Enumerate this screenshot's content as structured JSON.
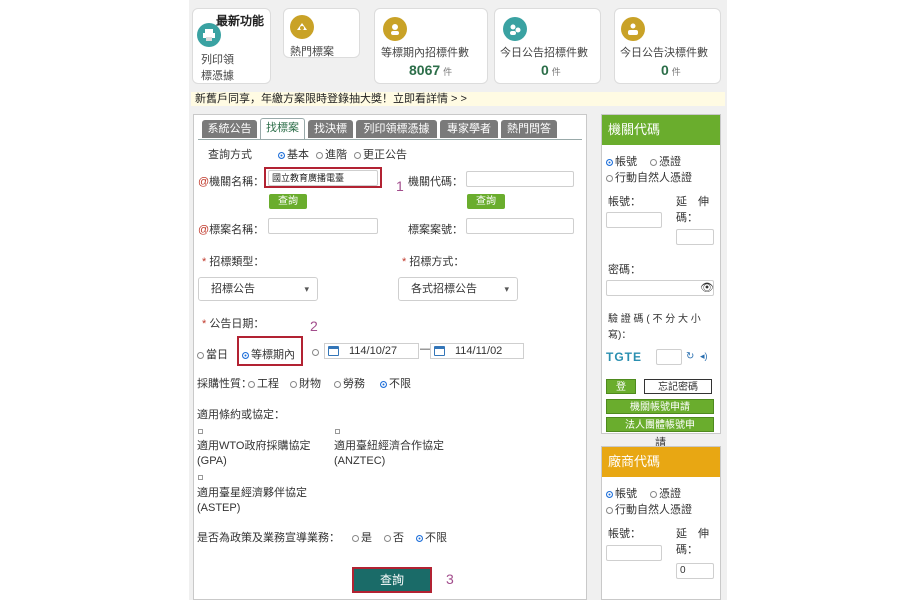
{
  "cards": {
    "latest_title": "最新功能",
    "print_label_1": "列印領",
    "print_label_2": "標憑據",
    "hot_label": "熱門標案",
    "bidding_label": "等標期內招標件數",
    "bidding_count": "8067",
    "today_tender_label": "今日公告招標件數",
    "today_tender_count": "0",
    "today_award_label": "今日公告決標件數",
    "today_award_count": "0",
    "unit": "件"
  },
  "marquee": "新舊戶同享，年繳方案限時登錄抽大獎！立即看詳情 > >",
  "tabs": [
    "系統公告",
    "找標案",
    "找決標",
    "列印領標憑據",
    "專家學者",
    "熱門問答"
  ],
  "form": {
    "query_mode_label": "查詢方式",
    "mode_basic": "基本",
    "mode_advanced": "進階",
    "mode_correction": "更正公告",
    "agency_name_label": "機關名稱：",
    "agency_name_value": "國立教育廣播電臺",
    "agency_code_label": "機關代碼：",
    "query_btn": "查詢",
    "tender_name_label": "標案名稱：",
    "tender_no_label": "標案案號：",
    "tender_type_label": "招標類型：",
    "tender_type_value": "招標公告",
    "tender_method_label": "招標方式：",
    "tender_method_value": "各式招標公告",
    "date_label": "公告日期：",
    "date_today": "當日",
    "date_period": "等標期內",
    "date_from": "114/10/27",
    "date_to": "114/11/02",
    "date_sep": "—",
    "procure_label": "採購性質：",
    "procure_work": "工程",
    "procure_goods": "財物",
    "procure_service": "勞務",
    "procure_all": "不限",
    "treaty_label": "適用條約或協定：",
    "gpa_1": "適用WTO政府採購協定",
    "gpa_2": "(GPA)",
    "anztec_1": "適用臺紐經濟合作協定",
    "anztec_2": "(ANZTEC)",
    "astep_1": "適用臺星經濟夥伴協定",
    "astep_2": "(ASTEP)",
    "policy_label": "是否為政策及業務宣導業務：",
    "policy_yes": "是",
    "policy_no": "否",
    "policy_all": "不限",
    "submit": "查詢"
  },
  "annotations": [
    "1",
    "2",
    "3"
  ],
  "agency_login": {
    "title": "機關代碼",
    "opt_account": "帳號",
    "opt_cert": "憑證",
    "opt_natural": "行動自然人憑證",
    "account_label": "帳號：",
    "ext_label_1": "延　伸",
    "ext_label_2": "碼：",
    "password_label": "密碼：",
    "captcha_label_1": "驗 證 碼 ( 不 分 大 小",
    "captcha_label_2": "寫)：",
    "captcha_text": "TGTE",
    "login_btn": "登",
    "forgot_btn": "忘記密碼",
    "apply_agency": "機關帳號申請",
    "apply_org": "法人團體帳號申",
    "apply_org_tail": "請"
  },
  "vendor_login": {
    "title": "廠商代碼",
    "opt_account": "帳號",
    "opt_cert": "憑證",
    "opt_natural": "行動自然人憑證",
    "account_label": "帳號：",
    "ext_label_1": "延　伸",
    "ext_label_2": "碼：",
    "ext_value": "0"
  },
  "colors": {
    "agency_header": "#6aad2d",
    "vendor_header": "#e8a713",
    "search_button": "#1a6b68",
    "annotation": "#a24d8c",
    "highlight_box": "#b22232"
  }
}
